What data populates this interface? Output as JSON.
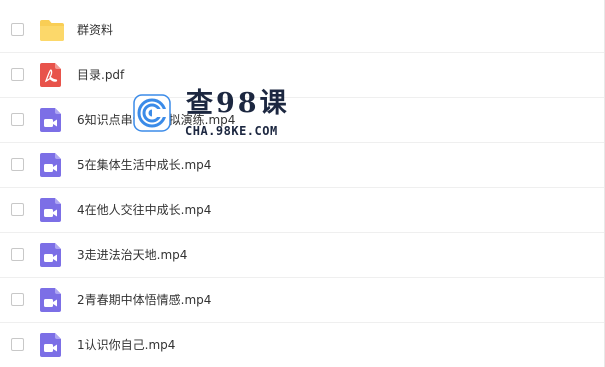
{
  "files": [
    {
      "name": "群资料",
      "icon": "folder-icon",
      "type": "folder"
    },
    {
      "name": "目录.pdf",
      "icon": "pdf-file-icon",
      "type": "pdf"
    },
    {
      "name": "6知识点串讲综合拟演练.mp4",
      "icon": "video-file-icon",
      "type": "video"
    },
    {
      "name": "5在集体生活中成长.mp4",
      "icon": "video-file-icon",
      "type": "video"
    },
    {
      "name": "4在他人交往中成长.mp4",
      "icon": "video-file-icon",
      "type": "video"
    },
    {
      "name": "3走进法治天地.mp4",
      "icon": "video-file-icon",
      "type": "video"
    },
    {
      "name": "2青春期中体悟情感.mp4",
      "icon": "video-file-icon",
      "type": "video"
    },
    {
      "name": "1认识你自己.mp4",
      "icon": "video-file-icon",
      "type": "video"
    }
  ],
  "watermark": {
    "title": "查98课",
    "url": "CHA.98KE.COM",
    "icon": "watermark-logo-icon"
  },
  "colors": {
    "folder": "#F9CE55",
    "pdf": "#E8534B",
    "video": "#7C6FE6",
    "text": "#333333"
  }
}
